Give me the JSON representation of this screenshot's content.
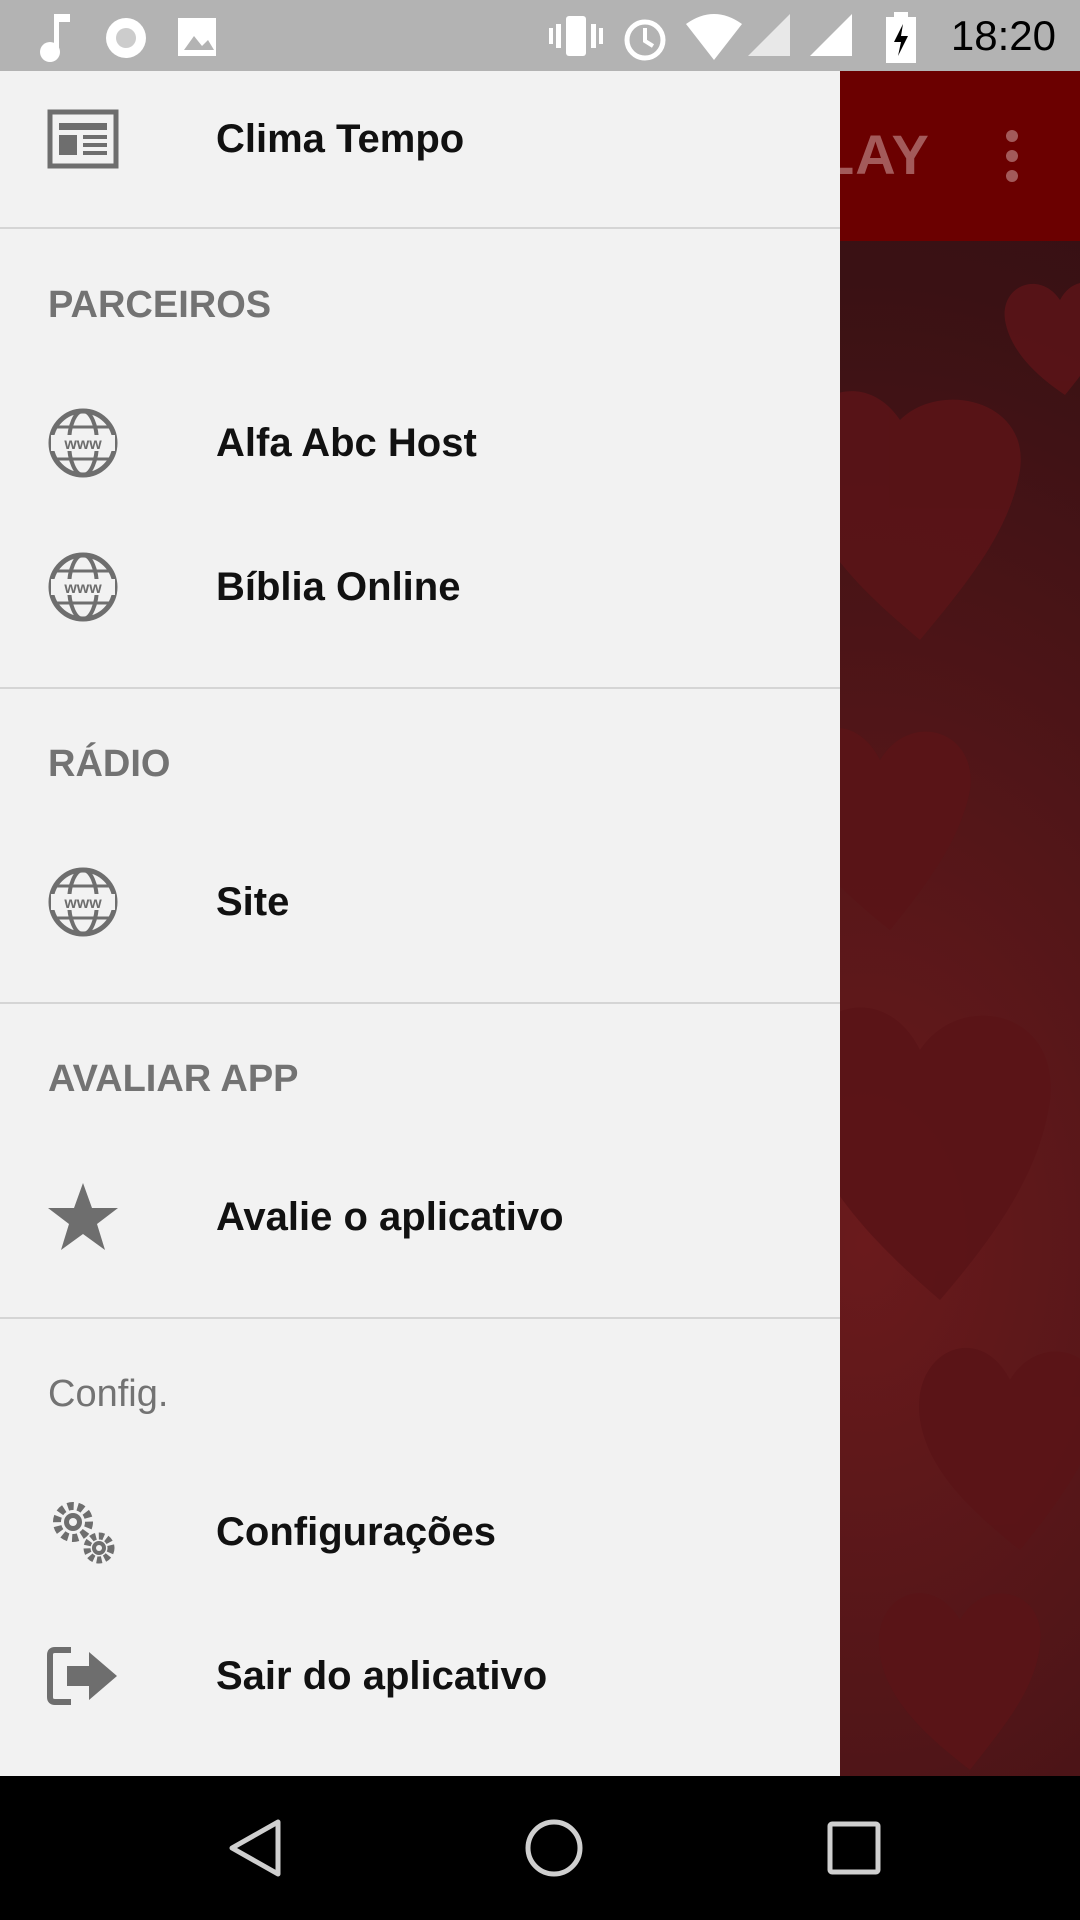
{
  "status_bar": {
    "time": "18:20",
    "icons": [
      "music-icon",
      "radio-icon",
      "image-icon",
      "vibrate-icon",
      "alarm-icon",
      "wifi-icon",
      "signal-icon",
      "signal-icon",
      "battery-charging-icon"
    ]
  },
  "app": {
    "toolbar_title": "LAY",
    "menu_icon": "overflow-icon",
    "accent_color": "#6b0000"
  },
  "drawer": {
    "items": [
      {
        "label": "Clima Tempo",
        "icon": "newspaper-icon"
      }
    ],
    "sections": [
      {
        "header": "PARCEIROS",
        "items": [
          {
            "label": "Alfa Abc Host",
            "icon": "web-globe-icon"
          },
          {
            "label": "Bíblia Online",
            "icon": "web-globe-icon"
          }
        ]
      },
      {
        "header": "RÁDIO",
        "items": [
          {
            "label": "Site",
            "icon": "web-globe-icon"
          }
        ]
      },
      {
        "header": "AVALIAR APP",
        "items": [
          {
            "label": "Avalie o aplicativo",
            "icon": "star-icon"
          }
        ]
      },
      {
        "header": "Config.",
        "items": [
          {
            "label": "Configurações",
            "icon": "gears-icon"
          },
          {
            "label": "Sair do aplicativo",
            "icon": "exit-icon"
          }
        ]
      }
    ]
  },
  "nav_bar": {
    "buttons": [
      "back-icon",
      "home-icon",
      "recents-icon"
    ]
  }
}
